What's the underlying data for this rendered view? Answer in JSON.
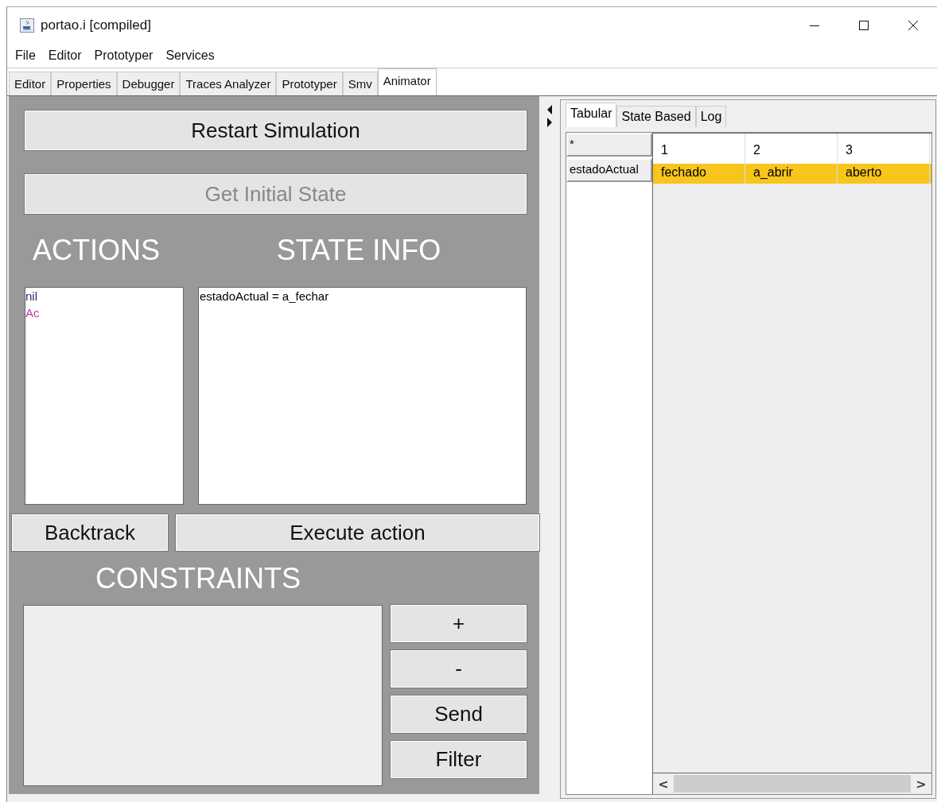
{
  "window": {
    "title": "portao.i [compiled]"
  },
  "menu": [
    "File",
    "Editor",
    "Prototyper",
    "Services"
  ],
  "tabs": [
    {
      "label": "Editor",
      "selected": false
    },
    {
      "label": "Properties",
      "selected": false
    },
    {
      "label": "Debugger",
      "selected": false
    },
    {
      "label": "Traces Analyzer",
      "selected": false
    },
    {
      "label": "Prototyper",
      "selected": false
    },
    {
      "label": "Smv",
      "selected": false
    },
    {
      "label": "Animator",
      "selected": true
    }
  ],
  "animator": {
    "restart_button": "Restart Simulation",
    "initial_state_button": {
      "label": "Get Initial State",
      "disabled": true
    },
    "actions_heading": "ACTIONS",
    "state_info_heading": "STATE INFO",
    "actions": [
      {
        "label": "nil",
        "color": "#2a2a66"
      },
      {
        "label": "Ac",
        "color": "#c03cac"
      }
    ],
    "state_info": [
      "estadoActual = a_fechar"
    ],
    "backtrack_button": "Backtrack",
    "execute_button": "Execute action",
    "constraints_heading": "CONSTRAINTS",
    "constraint_buttons": [
      "+",
      "-",
      "Send",
      "Filter"
    ]
  },
  "trace_tabs": [
    {
      "label": "Tabular",
      "selected": true
    },
    {
      "label": "State Based",
      "selected": false
    },
    {
      "label": "Log",
      "selected": false
    }
  ],
  "trace_table": {
    "corner": "*",
    "row_headers": [
      "estadoActual"
    ],
    "columns": [
      "1",
      "2",
      "3"
    ],
    "rows": [
      {
        "cells": [
          "fechado",
          "a_abrir",
          "aberto"
        ],
        "selected": true
      }
    ]
  },
  "scroll_buttons": [
    "<",
    ">"
  ]
}
